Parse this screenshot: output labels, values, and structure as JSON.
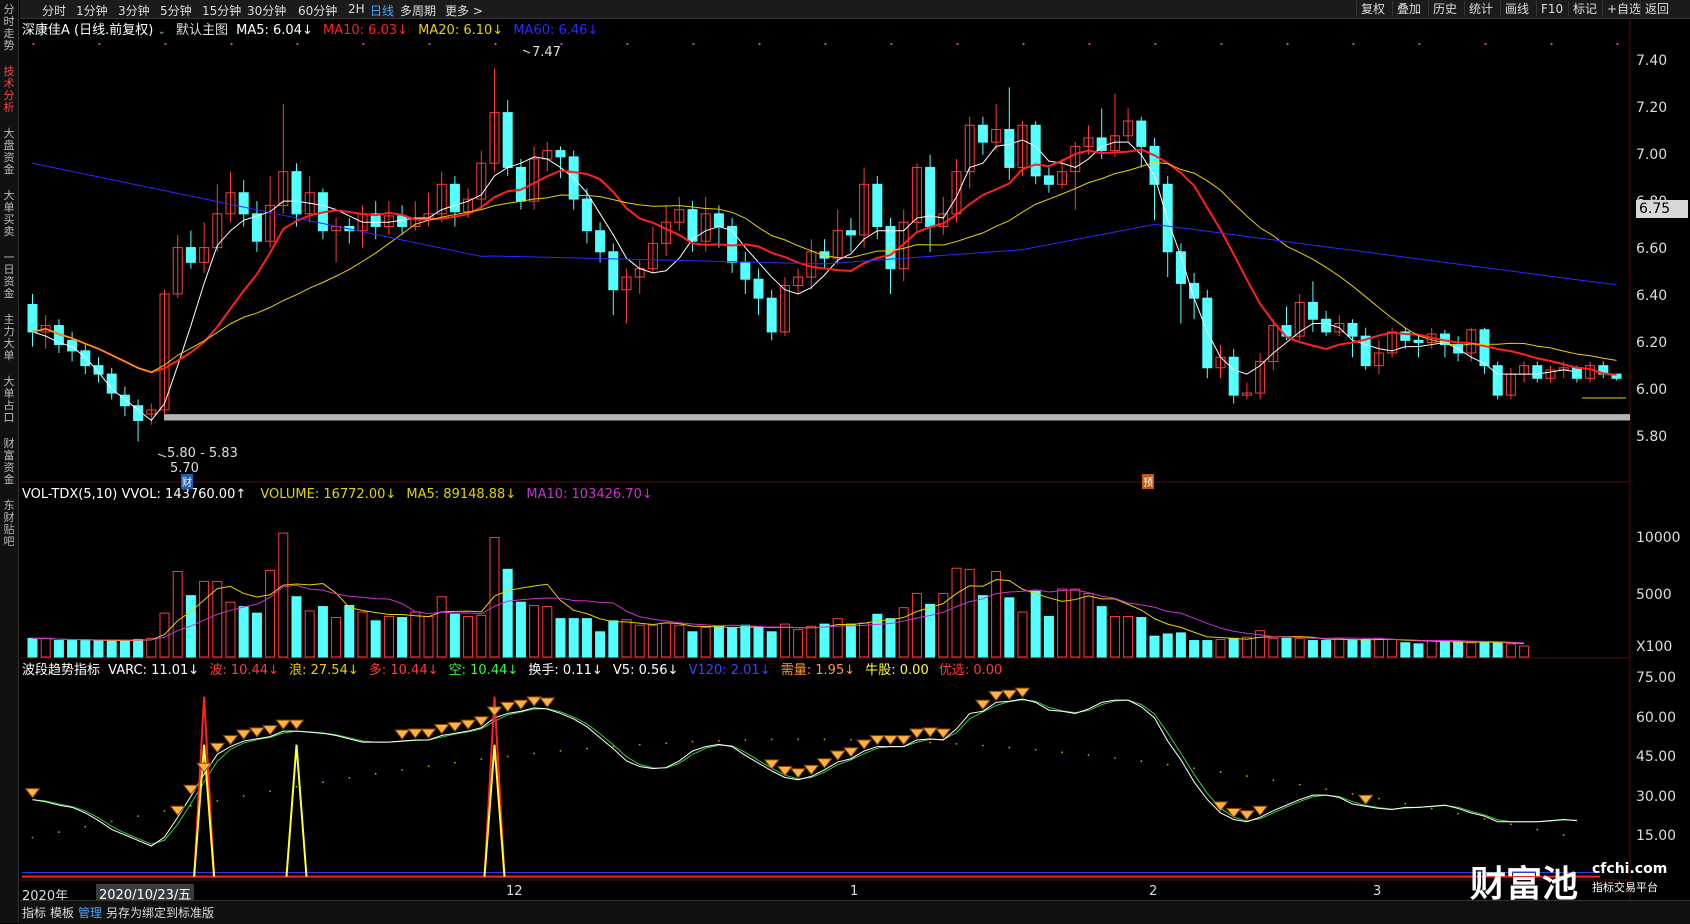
{
  "left_nav": [
    "分时走势",
    "技术分析",
    "大盘资金",
    "大单买卖",
    "一日资金",
    "主力大单",
    "大单占口",
    "财富资金",
    "东财贴吧"
  ],
  "timeframes": [
    "分时",
    "1分钟",
    "3分钟",
    "5分钟",
    "15分钟",
    "30分钟",
    "60分钟",
    "2H",
    "日线",
    "多周期",
    "更多 >"
  ],
  "active_timeframe": "日线",
  "right_buttons": [
    "复权",
    "叠加",
    "历史",
    "统计",
    "画线",
    "F10",
    "标记",
    "+自选",
    "返回"
  ],
  "main_header": {
    "stock": "深康佳A (日线.前复权)",
    "template": "默认主图",
    "ma5": "MA5: 6.04↓",
    "ma10": "MA10: 6.03↓",
    "ma20": "MA20: 6.10↓",
    "ma60": "MA60: 6.46↓"
  },
  "price_axis": [
    "7.40",
    "7.20",
    "7.00",
    "6.80",
    "6.60",
    "6.40",
    "6.20",
    "6.00",
    "5.80"
  ],
  "current_price": "6.75",
  "annotations": {
    "high": "7.47",
    "support_range": "5.80 - 5.83",
    "low": "5.70",
    "cai_marker": "财",
    "yu_marker": "预"
  },
  "vol_header": {
    "name": "VOL-TDX(5,10)",
    "vvol": "VVOL: 143760.00↑",
    "volume": "VOLUME: 16772.00↓",
    "ma5": "MA5: 89148.88↓",
    "ma10": "MA10: 103426.70↓"
  },
  "vol_axis": [
    "10000",
    "5000",
    "X100"
  ],
  "wave_header": {
    "name": "波段趋势指标",
    "varc": "VARC: 11.01↓",
    "bo": "波: 10.44↓",
    "lang": "浪: 27.54↓",
    "duo": "多: 10.44↓",
    "kong": "空: 10.44↓",
    "huanshou": "换手: 0.11↓",
    "v5": "V5: 0.56↓",
    "v120": "V120: 2.01↓",
    "xuliang": "需量: 1.95↓",
    "niugu": "牛股: 0.00",
    "youxuan": "优选: 0.00"
  },
  "wave_axis": [
    "75.00",
    "60.00",
    "45.00",
    "30.00",
    "15.00"
  ],
  "date_axis": {
    "year": "2020年",
    "cursor_date": "2020/10/23/五",
    "months": [
      "12",
      "1",
      "2",
      "3"
    ]
  },
  "bottom_tabs": [
    "指标",
    "模板",
    "管理",
    "另存为",
    "绑定到",
    "标准版"
  ],
  "active_bottom_tab": "管理",
  "watermark": {
    "brand": "财富池",
    "site": "cfchi.com",
    "tagline": "指标交易平台"
  },
  "colors": {
    "up": "#ff3b3b",
    "down": "#54ffff",
    "ma5": "#ffffff",
    "ma10": "#ff2020",
    "ma20": "#e6d200",
    "ma60": "#2a2aff",
    "vol_ma5": "#e6d200",
    "vol_ma10": "#cc33cc",
    "accent": "#4fa3ff"
  },
  "chart_data": {
    "type": "candlestick",
    "candles": [
      [
        6.35,
        6.22,
        6.4,
        6.15
      ],
      [
        6.22,
        6.25,
        6.3,
        6.14
      ],
      [
        6.25,
        6.16,
        6.28,
        6.12
      ],
      [
        6.18,
        6.13,
        6.22,
        6.08
      ],
      [
        6.13,
        6.06,
        6.16,
        6.02
      ],
      [
        6.06,
        6.02,
        6.1,
        5.98
      ],
      [
        6.02,
        5.93,
        6.05,
        5.9
      ],
      [
        5.92,
        5.87,
        5.96,
        5.82
      ],
      [
        5.87,
        5.8,
        5.9,
        5.7
      ],
      [
        5.83,
        5.85,
        5.88,
        5.78
      ],
      [
        5.85,
        6.4,
        6.42,
        5.83
      ],
      [
        6.4,
        6.62,
        6.68,
        6.38
      ],
      [
        6.62,
        6.55,
        6.7,
        6.52
      ],
      [
        6.55,
        6.62,
        6.74,
        6.5
      ],
      [
        6.62,
        6.78,
        6.92,
        6.6
      ],
      [
        6.78,
        6.88,
        6.98,
        6.74
      ],
      [
        6.88,
        6.78,
        6.94,
        6.72
      ],
      [
        6.78,
        6.65,
        6.84,
        6.6
      ],
      [
        6.65,
        6.82,
        6.96,
        6.62
      ],
      [
        6.82,
        6.98,
        7.3,
        6.78
      ],
      [
        6.98,
        6.78,
        7.02,
        6.72
      ],
      [
        6.78,
        6.88,
        6.96,
        6.74
      ],
      [
        6.88,
        6.7,
        6.9,
        6.66
      ],
      [
        6.7,
        6.72,
        6.76,
        6.55
      ],
      [
        6.72,
        6.7,
        6.76,
        6.64
      ],
      [
        6.7,
        6.78,
        6.82,
        6.62
      ],
      [
        6.78,
        6.72,
        6.84,
        6.66
      ],
      [
        6.72,
        6.77,
        6.84,
        6.68
      ],
      [
        6.77,
        6.72,
        6.82,
        6.68
      ],
      [
        6.72,
        6.76,
        6.84,
        6.7
      ],
      [
        6.76,
        6.78,
        6.88,
        6.72
      ],
      [
        6.78,
        6.92,
        6.98,
        6.74
      ],
      [
        6.92,
        6.79,
        6.96,
        6.72
      ],
      [
        6.79,
        6.85,
        6.9,
        6.76
      ],
      [
        6.85,
        7.02,
        7.08,
        6.8
      ],
      [
        7.02,
        7.26,
        7.47,
        6.98
      ],
      [
        7.26,
        7.0,
        7.32,
        6.96
      ],
      [
        7.0,
        6.84,
        7.04,
        6.8
      ],
      [
        6.84,
        7.04,
        7.1,
        6.8
      ],
      [
        7.04,
        7.08,
        7.12,
        6.98
      ],
      [
        7.08,
        7.05,
        7.1,
        6.95
      ],
      [
        7.05,
        6.85,
        7.08,
        6.8
      ],
      [
        6.85,
        6.7,
        6.9,
        6.64
      ],
      [
        6.7,
        6.6,
        6.74,
        6.55
      ],
      [
        6.6,
        6.42,
        6.64,
        6.3
      ],
      [
        6.42,
        6.48,
        6.52,
        6.26
      ],
      [
        6.48,
        6.52,
        6.56,
        6.4
      ],
      [
        6.52,
        6.64,
        6.72,
        6.5
      ],
      [
        6.64,
        6.74,
        6.82,
        6.58
      ],
      [
        6.74,
        6.8,
        6.86,
        6.7
      ],
      [
        6.8,
        6.65,
        6.84,
        6.6
      ],
      [
        6.65,
        6.78,
        6.86,
        6.6
      ],
      [
        6.78,
        6.72,
        6.82,
        6.62
      ],
      [
        6.72,
        6.55,
        6.76,
        6.5
      ],
      [
        6.55,
        6.47,
        6.6,
        6.4
      ],
      [
        6.47,
        6.38,
        6.52,
        6.3
      ],
      [
        6.38,
        6.22,
        6.42,
        6.18
      ],
      [
        6.22,
        6.44,
        6.48,
        6.2
      ],
      [
        6.44,
        6.48,
        6.52,
        6.4
      ],
      [
        6.48,
        6.6,
        6.66,
        6.42
      ],
      [
        6.6,
        6.57,
        6.66,
        6.52
      ],
      [
        6.57,
        6.7,
        6.8,
        6.54
      ],
      [
        6.7,
        6.68,
        6.76,
        6.6
      ],
      [
        6.68,
        6.92,
        7.0,
        6.62
      ],
      [
        6.92,
        6.72,
        6.96,
        6.66
      ],
      [
        6.72,
        6.52,
        6.76,
        6.4
      ],
      [
        6.52,
        6.74,
        6.8,
        6.46
      ],
      [
        6.74,
        7.0,
        7.02,
        6.7
      ],
      [
        7.0,
        6.72,
        7.06,
        6.6
      ],
      [
        6.72,
        6.78,
        6.86,
        6.68
      ],
      [
        6.78,
        6.98,
        7.04,
        6.74
      ],
      [
        6.98,
        7.2,
        7.24,
        6.9
      ],
      [
        7.2,
        7.12,
        7.24,
        7.06
      ],
      [
        7.12,
        7.18,
        7.3,
        7.08
      ],
      [
        7.18,
        7.0,
        7.38,
        6.94
      ],
      [
        7.0,
        7.2,
        7.22,
        6.96
      ],
      [
        7.2,
        6.96,
        7.22,
        6.92
      ],
      [
        6.96,
        6.92,
        7.0,
        6.88
      ],
      [
        6.92,
        6.98,
        7.04,
        6.9
      ],
      [
        6.98,
        7.1,
        7.12,
        6.8
      ],
      [
        7.1,
        7.14,
        7.2,
        7.06
      ],
      [
        7.14,
        7.08,
        7.28,
        7.04
      ],
      [
        7.08,
        7.15,
        7.35,
        7.05
      ],
      [
        7.15,
        7.22,
        7.28,
        7.12
      ],
      [
        7.22,
        7.1,
        7.24,
        7.0
      ],
      [
        7.1,
        6.92,
        7.14,
        6.75
      ],
      [
        6.92,
        6.6,
        6.96,
        6.48
      ],
      [
        6.6,
        6.45,
        6.64,
        6.26
      ],
      [
        6.45,
        6.38,
        6.5,
        6.28
      ],
      [
        6.38,
        6.05,
        6.42,
        6.0
      ],
      [
        6.05,
        6.1,
        6.16,
        6.0
      ],
      [
        6.1,
        5.92,
        6.14,
        5.88
      ],
      [
        5.92,
        5.93,
        5.98,
        5.9
      ],
      [
        5.93,
        6.08,
        6.12,
        5.9
      ],
      [
        6.08,
        6.25,
        6.28,
        6.04
      ],
      [
        6.25,
        6.2,
        6.34,
        6.18
      ],
      [
        6.2,
        6.36,
        6.4,
        6.18
      ],
      [
        6.36,
        6.28,
        6.46,
        6.22
      ],
      [
        6.28,
        6.22,
        6.32,
        6.2
      ],
      [
        6.22,
        6.26,
        6.3,
        6.2
      ],
      [
        6.26,
        6.2,
        6.28,
        6.1
      ],
      [
        6.2,
        6.06,
        6.24,
        6.04
      ],
      [
        6.06,
        6.12,
        6.18,
        6.02
      ],
      [
        6.12,
        6.22,
        6.24,
        6.1
      ],
      [
        6.22,
        6.18,
        6.24,
        6.14
      ],
      [
        6.18,
        6.17,
        6.2,
        6.1
      ],
      [
        6.17,
        6.21,
        6.24,
        6.14
      ],
      [
        6.21,
        6.16,
        6.23,
        6.1
      ],
      [
        6.16,
        6.12,
        6.2,
        6.08
      ],
      [
        6.12,
        6.23,
        6.24,
        6.08
      ],
      [
        6.23,
        6.06,
        6.24,
        6.02
      ],
      [
        6.06,
        5.92,
        6.08,
        5.9
      ],
      [
        5.92,
        6.02,
        6.05,
        5.9
      ],
      [
        6.02,
        6.06,
        6.08,
        5.98
      ],
      [
        6.06,
        6.0,
        6.08,
        5.98
      ],
      [
        6.0,
        6.04,
        6.06,
        5.98
      ],
      [
        6.04,
        6.05,
        6.08,
        6.0
      ],
      [
        6.05,
        6.0,
        6.06,
        5.98
      ],
      [
        6.0,
        6.06,
        6.08,
        5.98
      ],
      [
        6.06,
        6.02,
        6.08,
        6.0
      ],
      [
        6.02,
        6.0,
        6.02,
        5.99
      ]
    ],
    "volumes": [
      1.7,
      1.7,
      1.5,
      1.5,
      1.5,
      1.5,
      1.5,
      1.5,
      1.6,
      1.7,
      4.0,
      7.8,
      5.6,
      6.9,
      6.9,
      5.0,
      4.6,
      4.0,
      7.9,
      11.3,
      5.5,
      4.2,
      4.6,
      3.6,
      4.7,
      4.1,
      3.3,
      3.7,
      3.6,
      4.1,
      3.7,
      5.5,
      3.9,
      3.7,
      3.8,
      10.9,
      8.0,
      5.0,
      4.7,
      4.6,
      3.5,
      3.5,
      3.5,
      2.3,
      3.3,
      3.4,
      2.9,
      2.9,
      3.1,
      2.9,
      2.3,
      2.7,
      2.8,
      2.7,
      2.9,
      2.7,
      2.3,
      3.0,
      2.5,
      2.8,
      3.0,
      3.5,
      3.0,
      3.1,
      3.9,
      3.5,
      4.5,
      5.8,
      4.8,
      5.8,
      8.1,
      8.0,
      5.6,
      7.8,
      5.4,
      4.1,
      6.0,
      3.7,
      6.2,
      6.2,
      5.8,
      4.6,
      3.7,
      3.7,
      3.6,
      1.9,
      2.1,
      2.2,
      1.5,
      1.5,
      1.6,
      1.7,
      1.8,
      2.4,
      1.7,
      1.7,
      1.7,
      1.5,
      1.5,
      1.7,
      1.5,
      1.6,
      1.7,
      1.6,
      1.3,
      1.2,
      1.5,
      1.4,
      1.4,
      1.3,
      1.3,
      1.3,
      1.2,
      1.0
    ],
    "ma5": [
      6.22,
      6.2,
      6.17,
      6.15,
      6.1,
      6.03,
      5.95,
      5.9,
      5.85,
      5.8,
      5.88,
      6.06,
      6.25,
      6.45,
      6.63,
      6.7,
      6.75,
      6.77,
      6.79,
      6.84,
      6.84,
      6.83,
      6.82,
      6.8,
      6.77,
      6.74,
      6.74,
      6.74,
      6.75,
      6.76,
      6.76,
      6.8,
      6.82,
      6.84,
      6.87,
      6.96,
      7.0,
      7.02,
      7.05,
      7.04,
      7.0,
      6.95,
      6.88,
      6.78,
      6.68,
      6.57,
      6.52,
      6.5,
      6.51,
      6.57,
      6.66,
      6.7,
      6.72,
      6.7,
      6.62,
      6.55,
      6.48,
      6.42,
      6.4,
      6.43,
      6.49,
      6.56,
      6.59,
      6.66,
      6.7,
      6.7,
      6.7,
      6.76,
      6.77,
      6.76,
      6.86,
      7.0,
      7.02,
      7.1,
      7.11,
      7.13,
      7.1,
      7.03,
      7.02,
      7.0,
      7.04,
      7.1,
      7.12,
      7.12,
      7.06,
      6.96,
      6.75,
      6.58,
      6.38,
      6.22,
      6.1,
      6.04,
      6.02,
      6.06,
      6.12,
      6.17,
      6.22,
      6.26,
      6.26,
      6.24,
      6.18,
      6.16,
      6.14,
      6.13,
      6.15,
      6.15,
      6.16,
      6.17,
      6.14,
      6.1,
      6.07,
      6.02,
      6.02,
      6.02,
      6.02,
      6.03,
      6.04,
      6.03
    ]
  }
}
